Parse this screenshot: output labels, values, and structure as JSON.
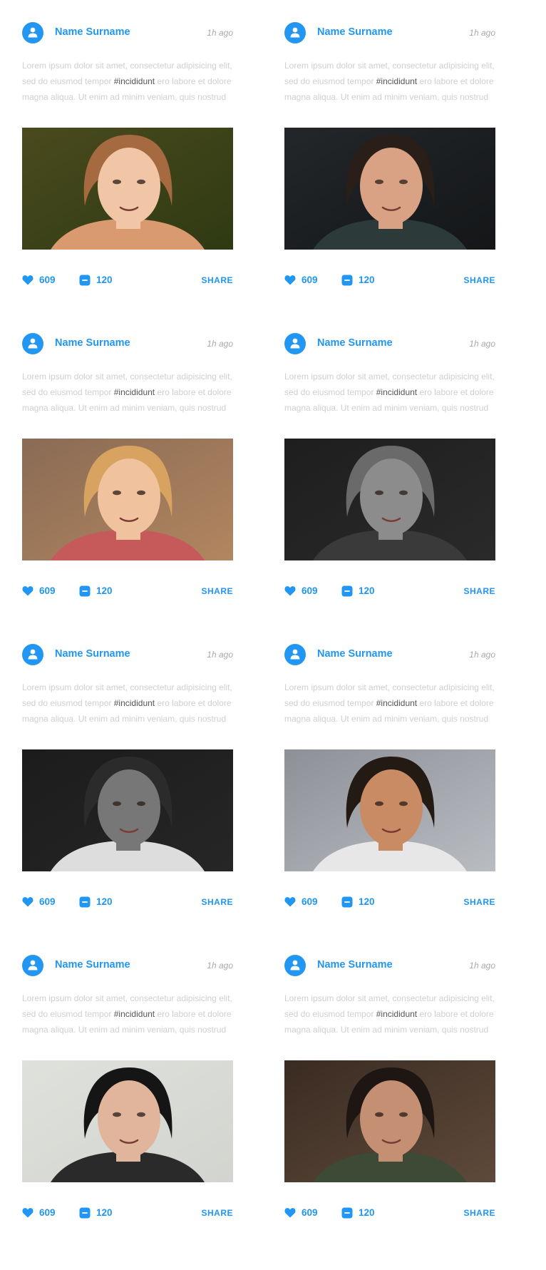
{
  "theme": {
    "accent": "#2196f3",
    "muted": "#cfcfcf",
    "time": "#a9a9a9",
    "hashtag": "#555555"
  },
  "posts": [
    {
      "author": "Name Surname",
      "time": "1h ago",
      "text_before": "Lorem ipsum dolor sit amet, consectetur adipisicing elit, sed do eiusmod tempor ",
      "hashtag": "#incididunt",
      "text_after": " ero labore et dolore magna aliqua. Ut enim ad minim veniam, quis nostrud",
      "likes": "609",
      "comments": "120",
      "share_label": "SHARE",
      "photo": {
        "bg": [
          "#4a4a1e",
          "#2f3a12"
        ],
        "skin": "#f1c6a6",
        "hair": "#a66a40",
        "shirt": "#d89a6e"
      }
    },
    {
      "author": "Name Surname",
      "time": "1h ago",
      "text_before": "Lorem ipsum dolor sit amet, consectetur adipisicing elit, sed do eiusmod tempor ",
      "hashtag": "#incididunt",
      "text_after": " ero labore et dolore magna aliqua. Ut enim ad minim veniam, quis nostrud",
      "likes": "609",
      "comments": "120",
      "share_label": "SHARE",
      "photo": {
        "bg": [
          "#23272a",
          "#141618"
        ],
        "skin": "#d9a284",
        "hair": "#2a1e18",
        "shirt": "#2c3a3a"
      }
    },
    {
      "author": "Name Surname",
      "time": "1h ago",
      "text_before": "Lorem ipsum dolor sit amet, consectetur adipisicing elit, sed do eiusmod tempor ",
      "hashtag": "#incididunt",
      "text_after": " ero labore et dolore magna aliqua. Ut enim ad minim veniam, quis nostrud",
      "likes": "609",
      "comments": "120",
      "share_label": "SHARE",
      "photo": {
        "bg": [
          "#8a6b55",
          "#b2865f"
        ],
        "skin": "#f0c29d",
        "hair": "#d8a360",
        "shirt": "#c65a5a"
      }
    },
    {
      "author": "Name Surname",
      "time": "1h ago",
      "text_before": "Lorem ipsum dolor sit amet, consectetur adipisicing elit, sed do eiusmod tempor ",
      "hashtag": "#incididunt",
      "text_after": " ero labore et dolore magna aliqua. Ut enim ad minim veniam, quis nostrud",
      "likes": "609",
      "comments": "120",
      "share_label": "SHARE",
      "photo": {
        "bg": [
          "#1e1e1e",
          "#2a2a2a"
        ],
        "skin": "#8c8c8c",
        "hair": "#6a6a6a",
        "shirt": "#3a3a3a"
      }
    },
    {
      "author": "Name Surname",
      "time": "1h ago",
      "text_before": "Lorem ipsum dolor sit amet, consectetur adipisicing elit, sed do eiusmod tempor ",
      "hashtag": "#incididunt",
      "text_after": " ero labore et dolore magna aliqua. Ut enim ad minim veniam, quis nostrud",
      "likes": "609",
      "comments": "120",
      "share_label": "SHARE",
      "photo": {
        "bg": [
          "#1c1c1c",
          "#262626"
        ],
        "skin": "#777777",
        "hair": "#2b2b2b",
        "shirt": "#dddddd"
      }
    },
    {
      "author": "Name Surname",
      "time": "1h ago",
      "text_before": "Lorem ipsum dolor sit amet, consectetur adipisicing elit, sed do eiusmod tempor ",
      "hashtag": "#incididunt",
      "text_after": " ero labore et dolore magna aliqua. Ut enim ad minim veniam, quis nostrud",
      "likes": "609",
      "comments": "120",
      "share_label": "SHARE",
      "photo": {
        "bg": [
          "#8d9096",
          "#b9bcc1"
        ],
        "skin": "#c98b63",
        "hair": "#241a14",
        "shirt": "#e7e7e7"
      }
    },
    {
      "author": "Name Surname",
      "time": "1h ago",
      "text_before": "Lorem ipsum dolor sit amet, consectetur adipisicing elit, sed do eiusmod tempor ",
      "hashtag": "#incididunt",
      "text_after": " ero labore et dolore magna aliqua. Ut enim ad minim veniam, quis nostrud",
      "likes": "609",
      "comments": "120",
      "share_label": "SHARE",
      "photo": {
        "bg": [
          "#dfe1dc",
          "#d2d4cf"
        ],
        "skin": "#e0b59b",
        "hair": "#151515",
        "shirt": "#2a2a2a"
      }
    },
    {
      "author": "Name Surname",
      "time": "1h ago",
      "text_before": "Lorem ipsum dolor sit amet, consectetur adipisicing elit, sed do eiusmod tempor ",
      "hashtag": "#incididunt",
      "text_after": " ero labore et dolore magna aliqua. Ut enim ad minim veniam, quis nostrud",
      "likes": "609",
      "comments": "120",
      "share_label": "SHARE",
      "photo": {
        "bg": [
          "#3a2b22",
          "#5e4a3a"
        ],
        "skin": "#c48f72",
        "hair": "#1e1612",
        "shirt": "#3c4a36"
      }
    }
  ]
}
